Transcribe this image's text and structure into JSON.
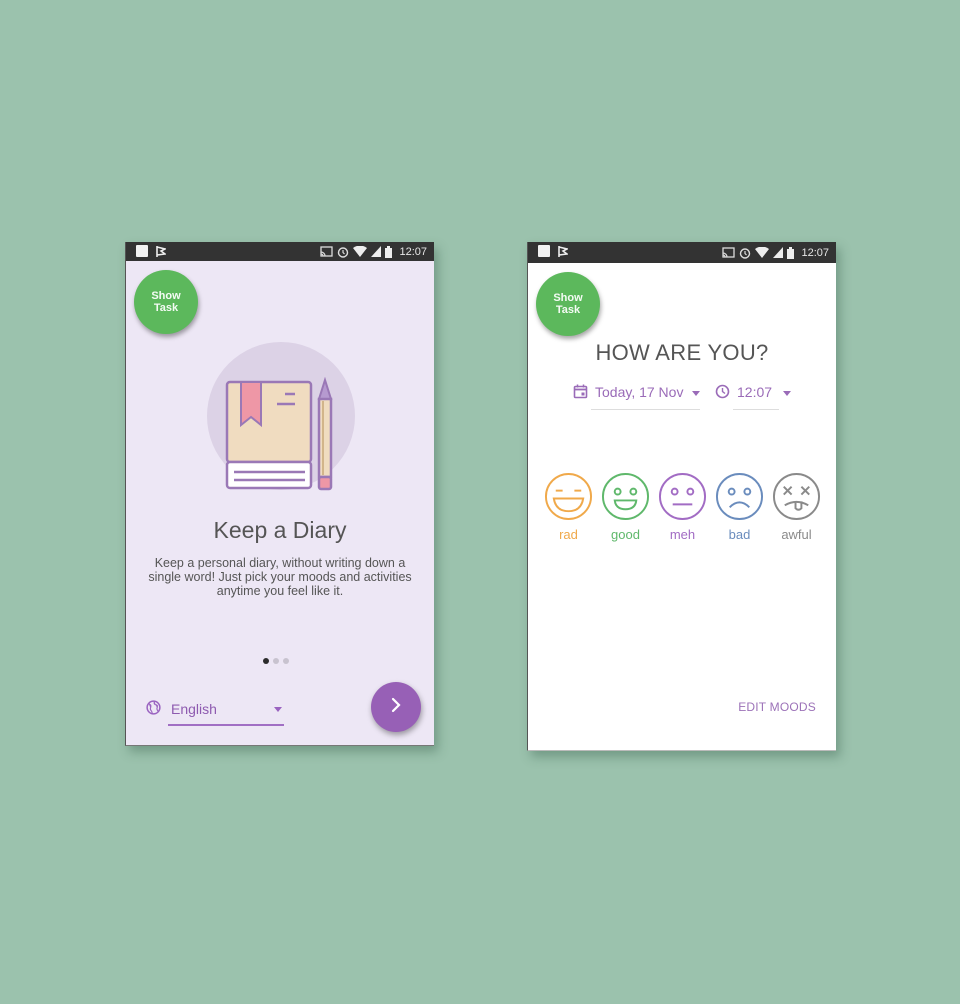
{
  "colors": {
    "background": "#9bc2ad",
    "status_bar": "#333333",
    "show_task": "#5cb85c",
    "accent_purple": "#9760b6",
    "mood_rad": "#f0a94a",
    "mood_good": "#5fb86b",
    "mood_meh": "#a26cc4",
    "mood_bad": "#6a8cbd",
    "mood_awful": "#8a8a8a"
  },
  "left_phone": {
    "status_bar": {
      "left_icons": [
        "notification-square-icon",
        "app-notification-icon"
      ],
      "right_icons": [
        "cast-icon",
        "alarm-icon",
        "wifi-icon",
        "cell-signal-icon",
        "battery-icon"
      ],
      "time": "12:07"
    },
    "show_task": {
      "line1": "Show",
      "line2": "Task"
    },
    "illustration": "diary-book-and-pencil",
    "title": "Keep a Diary",
    "description": "Keep a personal diary, without writing down a single word! Just pick your moods and activities anytime you feel like it.",
    "pager": {
      "count": 3,
      "active_index": 0
    },
    "language": {
      "icon": "globe-icon",
      "value": "English"
    },
    "next_button": {
      "icon": "chevron-right-icon"
    }
  },
  "right_phone": {
    "status_bar": {
      "left_icons": [
        "notification-square-icon",
        "app-notification-icon"
      ],
      "right_icons": [
        "cast-icon",
        "alarm-icon",
        "wifi-icon",
        "cell-signal-icon",
        "battery-icon"
      ],
      "time": "12:07"
    },
    "show_task": {
      "line1": "Show",
      "line2": "Task"
    },
    "title": "HOW ARE YOU?",
    "date_picker": {
      "icon": "calendar-icon",
      "value": "Today, 17 Nov"
    },
    "time_picker": {
      "icon": "clock-icon",
      "value": "12:07"
    },
    "moods": [
      {
        "label": "rad",
        "icon": "laughing-face-icon"
      },
      {
        "label": "good",
        "icon": "smiling-face-icon"
      },
      {
        "label": "meh",
        "icon": "neutral-face-icon"
      },
      {
        "label": "bad",
        "icon": "sad-face-icon"
      },
      {
        "label": "awful",
        "icon": "dizzy-face-icon"
      }
    ],
    "edit_moods": "EDIT MOODS"
  }
}
